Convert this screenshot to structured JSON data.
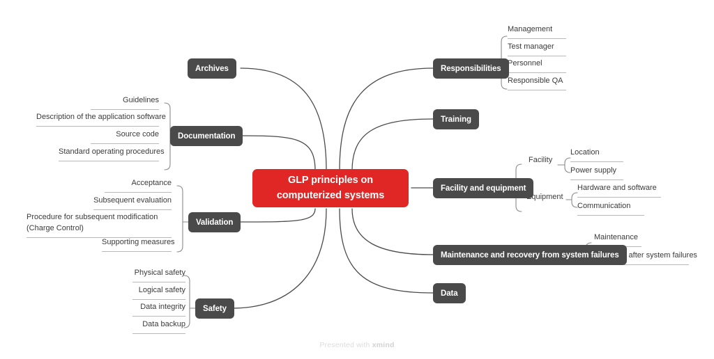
{
  "title": "GLP principles on computerized systems",
  "colors": {
    "root_fill": "#e02726",
    "branch_fill": "#4a4a4a",
    "root_text": "#ffffff",
    "branch_text": "#ffffff",
    "leaf_text": "#3a3a3a",
    "connector": "#4a4a4a",
    "leaf_rule": "#b9b9b9",
    "background": "#ffffff",
    "watermark_text": "#dcdcdc"
  },
  "root": {
    "label": "GLP principles on computerized systems"
  },
  "branches": {
    "responsibilities": {
      "label": "Responsibilities",
      "children": [
        {
          "label": "Management"
        },
        {
          "label": "Test manager"
        },
        {
          "label": "Personnel"
        },
        {
          "label": "Responsible QA"
        }
      ]
    },
    "training": {
      "label": "Training",
      "children": []
    },
    "facility_and_equipment": {
      "label": "Facility and equipment",
      "children": [
        {
          "label": "Facility",
          "children": [
            {
              "label": "Location"
            },
            {
              "label": "Power supply"
            }
          ]
        },
        {
          "label": "Equipment",
          "children": [
            {
              "label": "Hardware and software"
            },
            {
              "label": "Communication"
            }
          ]
        }
      ]
    },
    "maintenance": {
      "label": "Maintenance and recovery from system failures",
      "children": [
        {
          "label": "Maintenance"
        },
        {
          "label": "Recovery after system failures"
        }
      ]
    },
    "data": {
      "label": "Data",
      "children": []
    },
    "archives": {
      "label": "Archives",
      "children": []
    },
    "documentation": {
      "label": "Documentation",
      "children": [
        {
          "label": "Guidelines"
        },
        {
          "label": "Description of the application software"
        },
        {
          "label": "Source code"
        },
        {
          "label": "Standard operating procedures"
        }
      ]
    },
    "validation": {
      "label": "Validation",
      "children": [
        {
          "label": "Acceptance"
        },
        {
          "label": "Subsequent evaluation"
        },
        {
          "label": "Procedure for subsequent modification (Charge Control)"
        },
        {
          "label": "Supporting measures"
        }
      ]
    },
    "safety": {
      "label": "Safety",
      "children": [
        {
          "label": "Physical safety"
        },
        {
          "label": "Logical safety"
        },
        {
          "label": "Data integrity"
        },
        {
          "label": "Data backup"
        }
      ]
    }
  },
  "footer": {
    "prefix": "Presented with",
    "brand": "xmind"
  }
}
